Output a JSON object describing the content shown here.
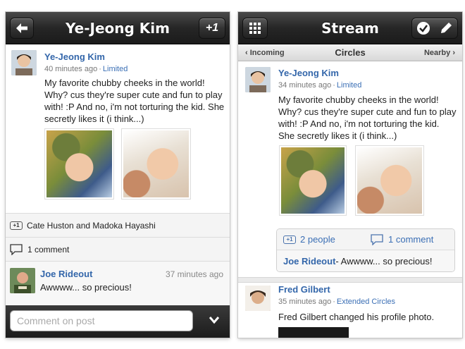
{
  "left": {
    "title": "Ye-Jeong Kim",
    "plus_one": "+1",
    "post": {
      "author": "Ye-Jeong Kim",
      "time": "40 minutes ago",
      "sep": "·",
      "visibility": "Limited",
      "text": "My favorite chubby cheeks in the world! Why? cus they're super cute and fun to play with! :P And no, i'm not torturing the kid. She secretly likes it (i think...)"
    },
    "plus_badge": "+1",
    "plusers": "Cate Huston and Madoka Hayashi",
    "comments_count": "1 comment",
    "comment": {
      "author": "Joe Rideout",
      "time": "37 minutes ago",
      "text": "Awwww... so precious!"
    },
    "comment_placeholder": "Comment on post"
  },
  "right": {
    "title": "Stream",
    "subnav": {
      "left": "‹ Incoming",
      "center": "Circles",
      "right": "Nearby ›"
    },
    "post": {
      "author": "Ye-Jeong Kim",
      "time": "34 minutes ago",
      "sep": "·",
      "visibility": "Limited",
      "text": "My favorite chubby cheeks in the world! Why? cus they're super cute and fun to play with! :P And no, i'm not torturing the kid. She secretly likes it (i think...)"
    },
    "plus_badge": "+1",
    "people": "2 people",
    "comments": "1 comment",
    "latest_comment_author": "Joe Rideout",
    "latest_comment_text": " - Awwww... so precious!",
    "post2": {
      "author": "Fred Gilbert",
      "time": "35 minutes ago",
      "sep": "·",
      "visibility": "Extended Circles",
      "text": "Fred Gilbert changed his profile photo."
    }
  },
  "colors": {
    "link": "#3366aa",
    "topbar": "#262626"
  },
  "icons": [
    "back-arrow-icon",
    "grid-icon",
    "checkmark-icon",
    "pencil-icon",
    "chevron-down-icon",
    "comment-bubble-icon",
    "plus-one-icon"
  ]
}
